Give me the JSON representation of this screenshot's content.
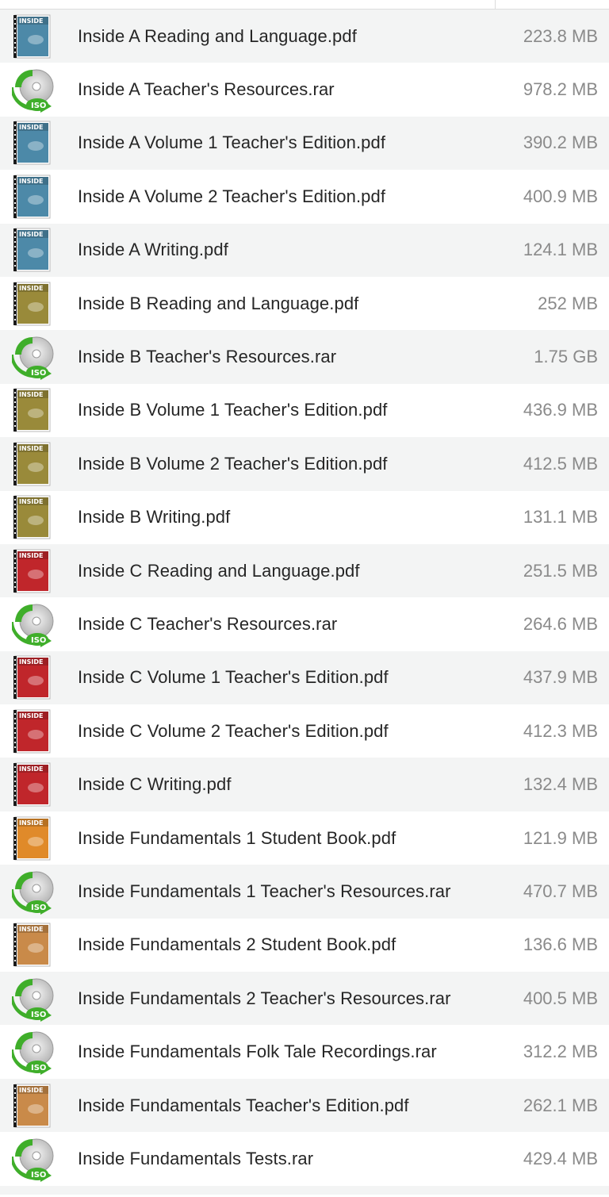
{
  "files": [
    {
      "name": "Inside A Reading and Language.pdf",
      "size": "223.8 MB",
      "icon": "pdf-book-icon",
      "cover": "#4d89a8"
    },
    {
      "name": "Inside A Teacher's Resources.rar",
      "size": "978.2 MB",
      "icon": "iso-disc-icon"
    },
    {
      "name": "Inside A Volume 1 Teacher's Edition.pdf",
      "size": "390.2 MB",
      "icon": "pdf-book-icon",
      "cover": "#4d89a8"
    },
    {
      "name": "Inside A Volume 2 Teacher's Edition.pdf",
      "size": "400.9 MB",
      "icon": "pdf-book-icon",
      "cover": "#4d89a8"
    },
    {
      "name": "Inside A Writing.pdf",
      "size": "124.1 MB",
      "icon": "pdf-book-icon",
      "cover": "#4d89a8"
    },
    {
      "name": "Inside B Reading and Language.pdf",
      "size": "252 MB",
      "icon": "pdf-book-icon",
      "cover": "#9a8a3a"
    },
    {
      "name": "Inside B Teacher's Resources.rar",
      "size": "1.75 GB",
      "icon": "iso-disc-icon"
    },
    {
      "name": "Inside B Volume 1 Teacher's Edition.pdf",
      "size": "436.9 MB",
      "icon": "pdf-book-icon",
      "cover": "#9a8a3a"
    },
    {
      "name": "Inside B Volume 2 Teacher's Edition.pdf",
      "size": "412.5 MB",
      "icon": "pdf-book-icon",
      "cover": "#9a8a3a"
    },
    {
      "name": "Inside B Writing.pdf",
      "size": "131.1 MB",
      "icon": "pdf-book-icon",
      "cover": "#9a8a3a"
    },
    {
      "name": "Inside C Reading and Language.pdf",
      "size": "251.5 MB",
      "icon": "pdf-book-icon",
      "cover": "#c0262b"
    },
    {
      "name": "Inside C Teacher's Resources.rar",
      "size": "264.6 MB",
      "icon": "iso-disc-icon"
    },
    {
      "name": "Inside C Volume 1 Teacher's Edition.pdf",
      "size": "437.9 MB",
      "icon": "pdf-book-icon",
      "cover": "#c0262b"
    },
    {
      "name": "Inside C Volume 2 Teacher's Edition.pdf",
      "size": "412.3 MB",
      "icon": "pdf-book-icon",
      "cover": "#c0262b"
    },
    {
      "name": "Inside C Writing.pdf",
      "size": "132.4 MB",
      "icon": "pdf-book-icon",
      "cover": "#c0262b"
    },
    {
      "name": "Inside Fundamentals 1 Student Book.pdf",
      "size": "121.9 MB",
      "icon": "pdf-book-icon",
      "cover": "#e08a2a"
    },
    {
      "name": "Inside Fundamentals 1 Teacher's Resources.rar",
      "size": "470.7 MB",
      "icon": "iso-disc-icon"
    },
    {
      "name": "Inside Fundamentals 2 Student Book.pdf",
      "size": "136.6 MB",
      "icon": "pdf-book-icon",
      "cover": "#c98a4a"
    },
    {
      "name": "Inside Fundamentals 2 Teacher's Resources.rar",
      "size": "400.5 MB",
      "icon": "iso-disc-icon"
    },
    {
      "name": "Inside Fundamentals Folk Tale Recordings.rar",
      "size": "312.2 MB",
      "icon": "iso-disc-icon"
    },
    {
      "name": "Inside Fundamentals Teacher's Edition.pdf",
      "size": "262.1 MB",
      "icon": "pdf-book-icon",
      "cover": "#c98a4a"
    },
    {
      "name": "Inside Fundamentals Tests.rar",
      "size": "429.4 MB",
      "icon": "iso-disc-icon"
    }
  ],
  "icon_labels": {
    "iso": "ISO",
    "cover": "INSIDE"
  }
}
